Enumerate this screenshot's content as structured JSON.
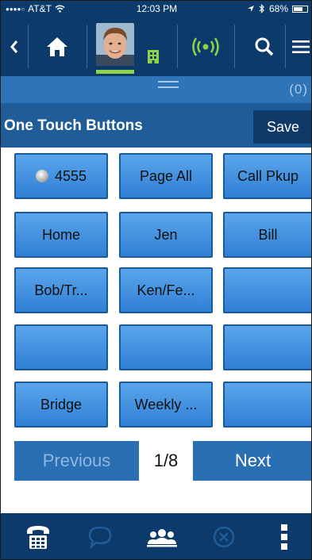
{
  "status_bar": {
    "carrier": "AT&T",
    "signal_dots": "●●●●○",
    "time": "12:03 PM",
    "battery": "68%",
    "battery_level": 0.68
  },
  "nav": {
    "icons": [
      "back-chevron-icon",
      "home-icon",
      "avatar",
      "building-icon",
      "wireless-signal-icon",
      "search-icon",
      "menu-icon"
    ],
    "colors": {
      "background": "#0c3a6b",
      "presence": "#8fd34a"
    }
  },
  "handle": {
    "count": "(0)"
  },
  "header": {
    "title": "One Touch Buttons",
    "save_label": "Save"
  },
  "grid": {
    "tiles": [
      {
        "label": "4555",
        "led": true
      },
      {
        "label": "Page All"
      },
      {
        "label": "Call Pkup"
      },
      {
        "label": "Home"
      },
      {
        "label": "Jen"
      },
      {
        "label": "Bill"
      },
      {
        "label": "Bob/Tr..."
      },
      {
        "label": "Ken/Fe..."
      },
      {
        "label": ""
      },
      {
        "label": ""
      },
      {
        "label": ""
      },
      {
        "label": ""
      },
      {
        "label": "Bridge"
      },
      {
        "label": "Weekly ..."
      },
      {
        "label": ""
      }
    ]
  },
  "pager": {
    "previous_label": "Previous",
    "page": "1/8",
    "next_label": "Next"
  },
  "tab_bar": {
    "tabs": [
      "dialpad-phone-icon",
      "chat-bubble-icon",
      "contacts-group-icon",
      "close-circle-icon",
      "more-vertical-icon"
    ]
  }
}
